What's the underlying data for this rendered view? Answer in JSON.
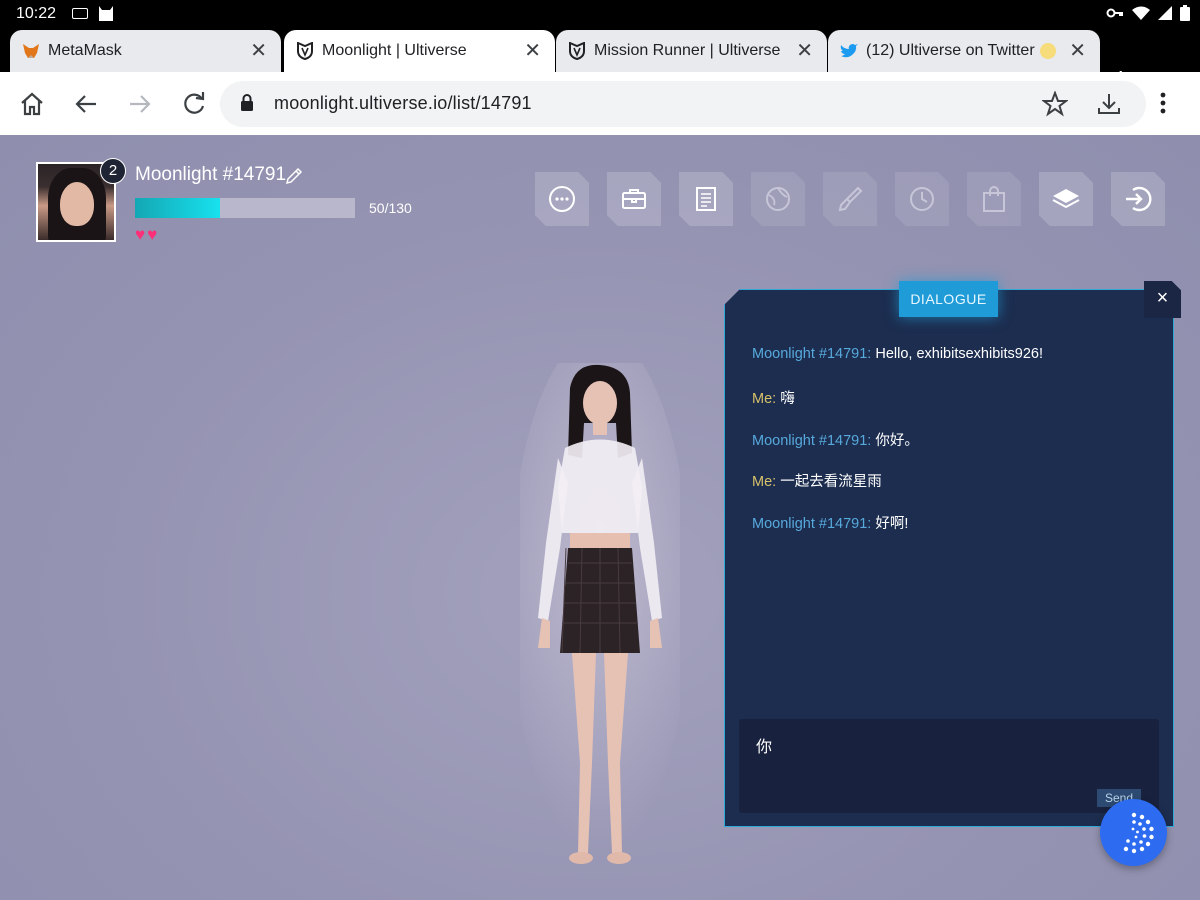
{
  "status_bar": {
    "time": "10:22"
  },
  "tabs": [
    {
      "title": "MetaMask",
      "icon": "metamask-fox-icon"
    },
    {
      "title": "Moonlight | Ultiverse",
      "icon": "ultiverse-shield-icon",
      "active": true
    },
    {
      "title": "Mission Runner | Ultiverse",
      "icon": "ultiverse-shield-icon"
    },
    {
      "title": "(12) Ultiverse on Twitter: \"",
      "icon": "twitter-bird-icon"
    }
  ],
  "toolbar": {
    "url": "moonlight.ultiverse.io/list/14791"
  },
  "profile": {
    "level": "2",
    "name": "Moonlight #14791",
    "xp_text": "50/130",
    "xp_current": 50,
    "xp_max": 130,
    "hearts": "♥♥"
  },
  "menu_icons": [
    "chat-icon",
    "briefcase-icon",
    "notes-icon",
    "globe-icon",
    "brush-icon",
    "clock-icon",
    "shopping-bag-icon",
    "book-icon",
    "exit-icon"
  ],
  "dialogue": {
    "title": "DIALOGUE",
    "close": "×",
    "messages": [
      {
        "speaker": "Moonlight #14791:",
        "text": " Hello, exhibitsexhibits926!",
        "role": "npc"
      },
      {
        "speaker": "Me:",
        "text": " 嗨",
        "role": "me"
      },
      {
        "speaker": "Moonlight #14791:",
        "text": " 你好。",
        "role": "npc"
      },
      {
        "speaker": "Me:",
        "text": " 一起去看流星雨",
        "role": "me"
      },
      {
        "speaker": "Moonlight #14791:",
        "text": " 好啊!",
        "role": "npc"
      }
    ],
    "input_value": "你",
    "send_label": "Send"
  },
  "colors": {
    "accent": "#1f9bd7",
    "npc_name": "#57a9dc",
    "me_name": "#d6c06a",
    "heart": "#ff2e79",
    "background": "#9594b2"
  }
}
